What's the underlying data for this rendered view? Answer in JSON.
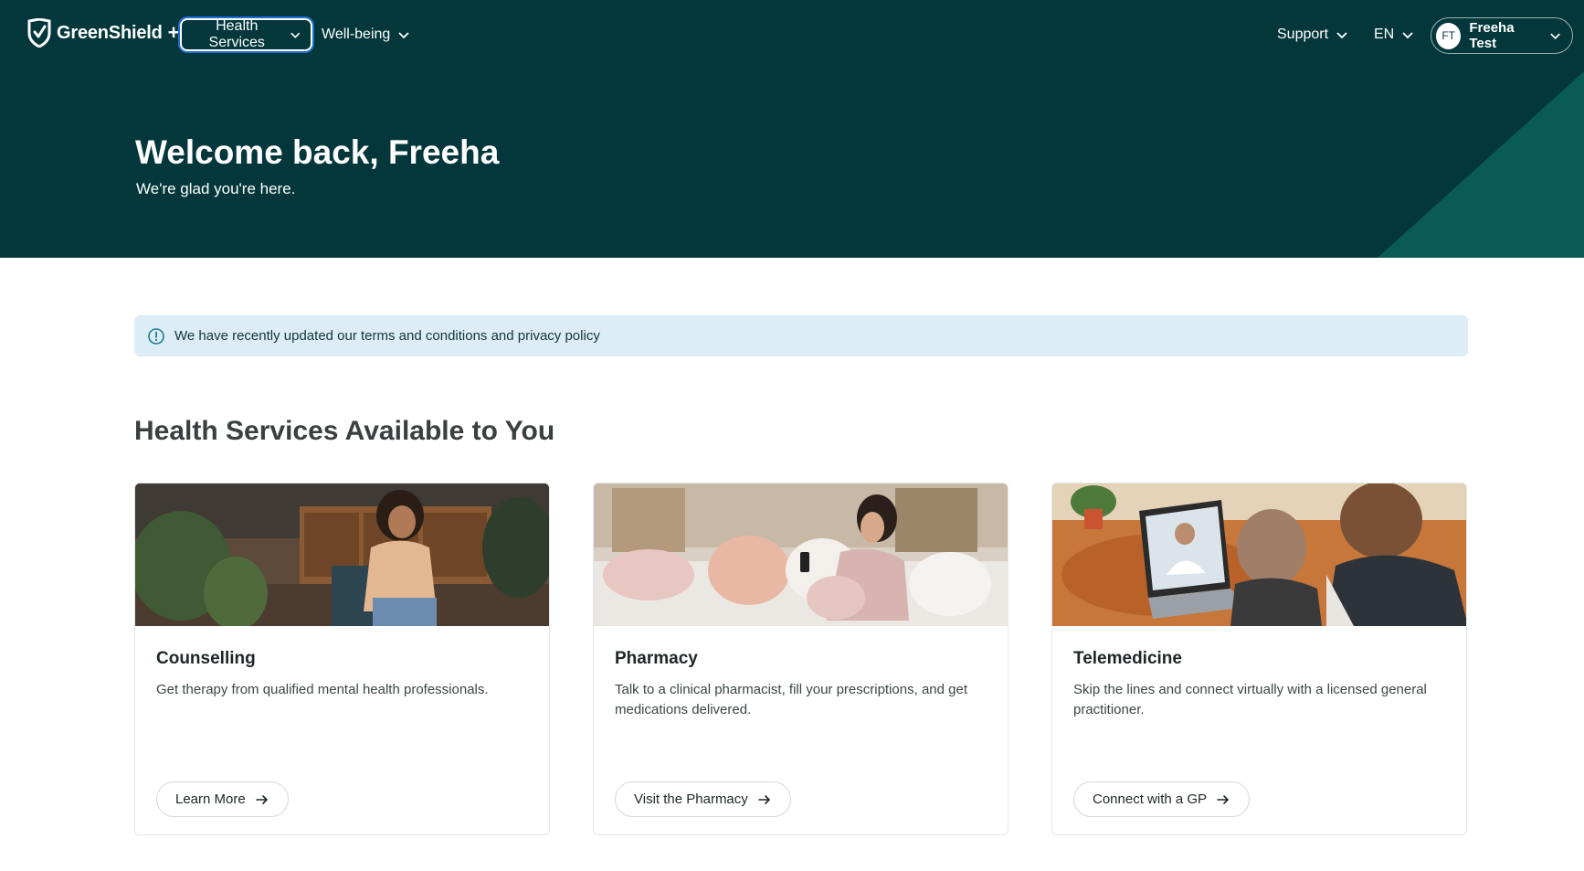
{
  "brand": {
    "name": "GreenShield",
    "plus": "+"
  },
  "nav": {
    "health_services": "Health Services",
    "well_being": "Well-being",
    "support": "Support",
    "language": "EN",
    "user_initials": "FT",
    "user_name": "Freeha Test"
  },
  "hero": {
    "title": "Welcome back, Freeha",
    "subtitle": "We're glad you're here."
  },
  "notice": {
    "text": "We have recently updated our terms and conditions and privacy policy"
  },
  "section": {
    "title": "Health Services Available to You"
  },
  "cards": [
    {
      "title": "Counselling",
      "description": "Get therapy from qualified mental health professionals.",
      "button": "Learn More"
    },
    {
      "title": "Pharmacy",
      "description": "Talk to a clinical pharmacist, fill your prescriptions, and get medications delivered.",
      "button": "Visit the Pharmacy"
    },
    {
      "title": "Telemedicine",
      "description": "Skip the lines and connect virtually with a licensed general practitioner.",
      "button": "Connect with a GP"
    }
  ],
  "colors": {
    "hero_bg": "#03373b",
    "hero_stripe": "#0a5a55",
    "notice_bg": "#dcedf7",
    "focus_ring": "#1f6fd6"
  }
}
